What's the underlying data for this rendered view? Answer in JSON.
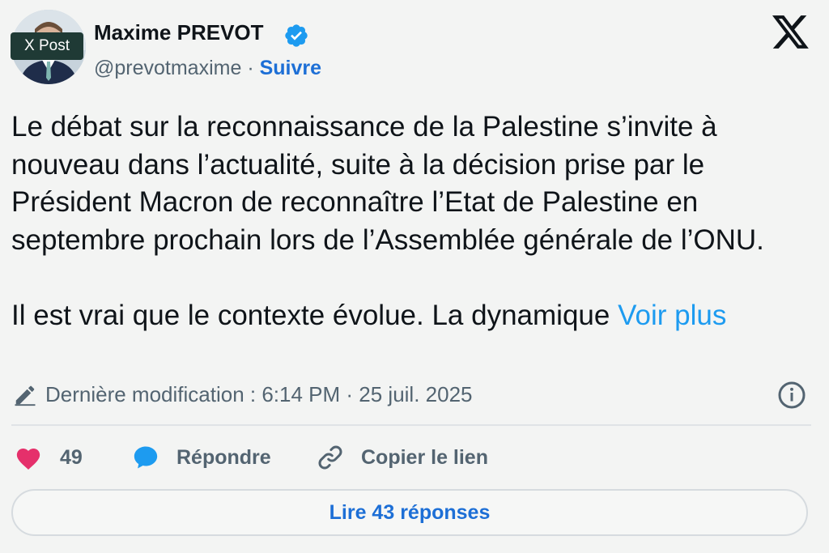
{
  "author": {
    "name": "Maxime PREVOT",
    "handle": "@prevotmaxime",
    "separator": "·",
    "follow_label": "Suivre",
    "badge_label": "X Post"
  },
  "post": {
    "paragraph1": "Le débat sur la reconnaissance de la Palestine s’invite à nouveau dans l’actualité, suite à la décision prise par le Président Macron de reconnaître l’Etat de Palestine en septembre prochain lors de l’Assemblée générale de l’ONU.",
    "paragraph2": "Il est vrai que le contexte évolue. La dynamique",
    "more_label": "Voir plus"
  },
  "meta": {
    "edited_label": "Dernière modification : 6:14 PM · 25 juil. 2025"
  },
  "actions": {
    "like_count": "49",
    "reply_label": "Répondre",
    "copy_label": "Copier le lien"
  },
  "read_replies_label": "Lire 43 réponses",
  "icons": {
    "platform": "x-logo-icon",
    "verified": "verified-icon",
    "edit": "pencil-icon",
    "info": "info-icon",
    "like": "heart-icon",
    "reply": "speech-bubble-icon",
    "link": "link-icon"
  },
  "colors": {
    "accent": "#1d9bf0",
    "like": "#e5306b",
    "text": "#0f1419",
    "muted": "#536471"
  }
}
